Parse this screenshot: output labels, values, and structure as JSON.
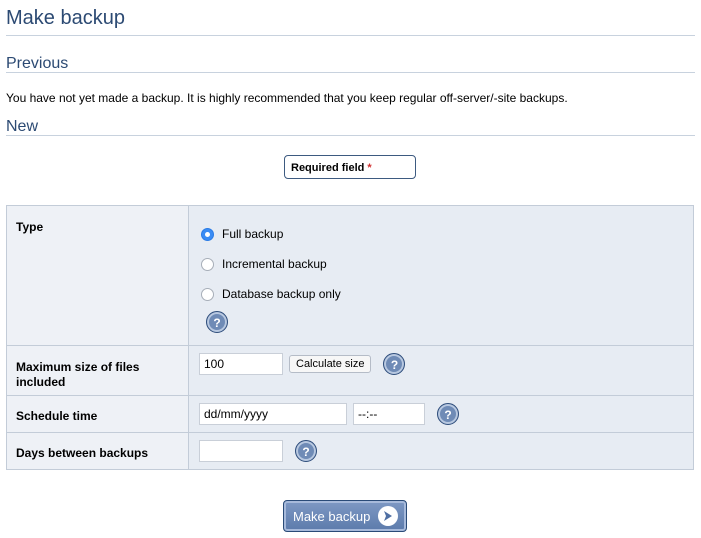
{
  "page": {
    "title": "Make backup"
  },
  "previous": {
    "heading": "Previous",
    "note": "You have not yet made a backup. It is highly recommended that you keep regular off-server/-site backups."
  },
  "new": {
    "heading": "New",
    "required_label": "Required field",
    "required_marker": "*"
  },
  "form": {
    "type": {
      "label": "Type",
      "options": [
        {
          "label": "Full backup",
          "checked": true
        },
        {
          "label": "Incremental backup",
          "checked": false
        },
        {
          "label": "Database backup only",
          "checked": false
        }
      ],
      "help": "?"
    },
    "max_size": {
      "label": "Maximum size of files included",
      "value": "100",
      "calculate_label": "Calculate size",
      "help": "?"
    },
    "schedule": {
      "label": "Schedule time",
      "date_value": "dd/mm/yyyy",
      "time_value": "--:--",
      "help": "?"
    },
    "days": {
      "label": "Days between backups",
      "value": "",
      "help": "?"
    }
  },
  "submit": {
    "label": "Make backup",
    "icon": "arrow-right-icon"
  },
  "colors": {
    "heading": "#2c4a73",
    "label_bg": "#eef1f6",
    "field_bg": "#e7ecf3",
    "button": "#5c7bab",
    "radio_checked": "#3a8cf4",
    "required_star": "#d03030"
  }
}
